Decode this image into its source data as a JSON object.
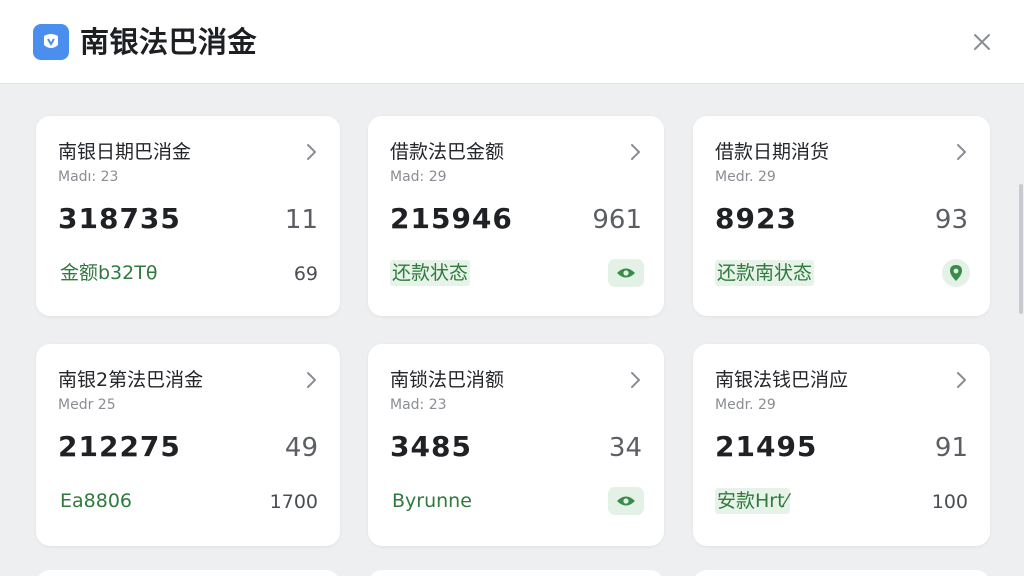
{
  "header": {
    "title": "南银法巴消金",
    "logo_icon": "app-logo-icon",
    "close_icon": "close-icon"
  },
  "colors": {
    "accent": "#4a8ef0",
    "status_green": "#2f7a3e",
    "status_bg": "#e7f3e9"
  },
  "cards": [
    {
      "title": "南银日期巴消金",
      "sub": "Madı: 23",
      "value": "318735",
      "count": "11",
      "status": "金额b32Tθ",
      "status_style": "plain",
      "right_text": "69",
      "right_type": "text"
    },
    {
      "title": "借款法巴金额",
      "sub": "Mad: 29",
      "value": "215946",
      "count": "961",
      "status": "还款状态",
      "status_style": "pill",
      "right_text": "",
      "right_type": "eye"
    },
    {
      "title": "借款日期消货",
      "sub": "Medr. 29",
      "value": "8923",
      "count": "93",
      "status": "还款南状态",
      "status_style": "pill",
      "right_text": "",
      "right_type": "pin"
    },
    {
      "title": "南银2第法巴消金",
      "sub": "Medr 25",
      "value": "212275",
      "count": "49",
      "status": "Ea8806",
      "status_style": "plain",
      "right_text": "1700",
      "right_type": "text"
    },
    {
      "title": "南锁法巴消额",
      "sub": "Mad: 23",
      "value": "3485",
      "count": "34",
      "status": "Byrunne",
      "status_style": "plain",
      "right_text": "",
      "right_type": "eye"
    },
    {
      "title": "南银法钱巴消应",
      "sub": "Medr. 29",
      "value": "21495",
      "count": "91",
      "status": "安款Hrt⁄",
      "status_style": "pill",
      "right_text": "100",
      "right_type": "text"
    }
  ]
}
